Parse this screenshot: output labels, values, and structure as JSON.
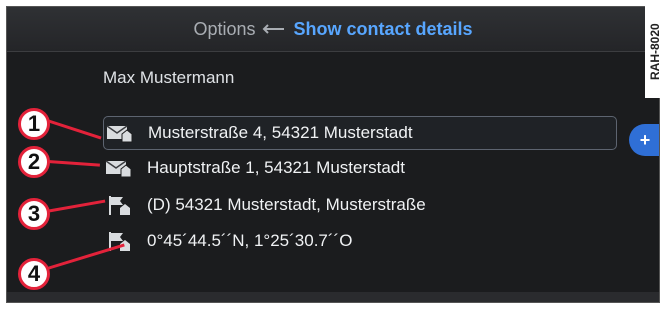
{
  "header": {
    "options_label": "Options",
    "active_title": "Show contact details",
    "reference_code": "RAH-8020"
  },
  "contact": {
    "name": "Max Mustermann",
    "entries": [
      {
        "icon": "envelope-home-icon",
        "text": "Musterstraße 4, 54321 Musterstadt",
        "selected": true
      },
      {
        "icon": "envelope-home-icon",
        "text": "Hauptstraße 1, 54321 Musterstadt",
        "selected": false
      },
      {
        "icon": "flag-destination-icon",
        "text": "(D) 54321 Musterstadt,  Musterstraße",
        "selected": false
      },
      {
        "icon": "flag-destination-icon",
        "text": "0°45´44.5´´N, 1°25´30.7´´O",
        "selected": false
      }
    ]
  },
  "side_button": {
    "label": "+"
  },
  "callouts": [
    "1",
    "2",
    "3",
    "4"
  ],
  "colors": {
    "accent": "#58a6ff",
    "callout_red": "#e3223a",
    "screen_bg": "#1b1c1e"
  }
}
